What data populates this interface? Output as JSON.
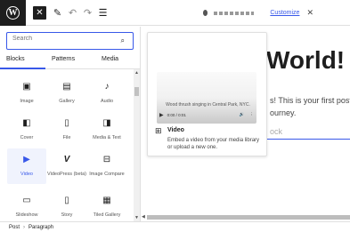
{
  "topbar": {
    "logo_glyph": "W",
    "customize_label": "Customize",
    "close_glyph": "✕",
    "pen_glyph": "✎",
    "undo_glyph": "↶",
    "redo_glyph": "↷",
    "list_glyph": "☰",
    "dismiss_glyph": "✕"
  },
  "inserter": {
    "search_placeholder": "Search",
    "search_icon_glyph": "⌕",
    "tabs": [
      {
        "label": "Blocks"
      },
      {
        "label": "Patterns"
      },
      {
        "label": "Media"
      }
    ],
    "blocks": [
      {
        "label": "Image",
        "glyph": "▣"
      },
      {
        "label": "Gallery",
        "glyph": "▤"
      },
      {
        "label": "Audio",
        "glyph": "♪"
      },
      {
        "label": "Cover",
        "glyph": "◧"
      },
      {
        "label": "File",
        "glyph": "▯"
      },
      {
        "label": "Media & Text",
        "glyph": "◨"
      },
      {
        "label": "Video",
        "glyph": "▶"
      },
      {
        "label": "VideoPress (beta)",
        "glyph": "V"
      },
      {
        "label": "Image Compare",
        "glyph": "⊟"
      },
      {
        "label": "Slideshow",
        "glyph": "▭"
      },
      {
        "label": "Story",
        "glyph": "▯"
      },
      {
        "label": "Tiled Gallery",
        "glyph": "▦"
      }
    ]
  },
  "canvas": {
    "headline": "World!",
    "paragraph_line1": "s! This is your first post. E",
    "paragraph_line2": "ourney.",
    "placeholder": "ock"
  },
  "preview": {
    "time": "0:00 / 0:01",
    "caption": "Wood thrush singing in Central Park, NYC.",
    "title": "Video",
    "description": "Embed a video from your media library or upload a new one."
  },
  "statusbar": {
    "crumbs": [
      "Post",
      "Paragraph"
    ]
  },
  "colors": {
    "accent": "#3858e9",
    "dark": "#1e1e1e"
  }
}
